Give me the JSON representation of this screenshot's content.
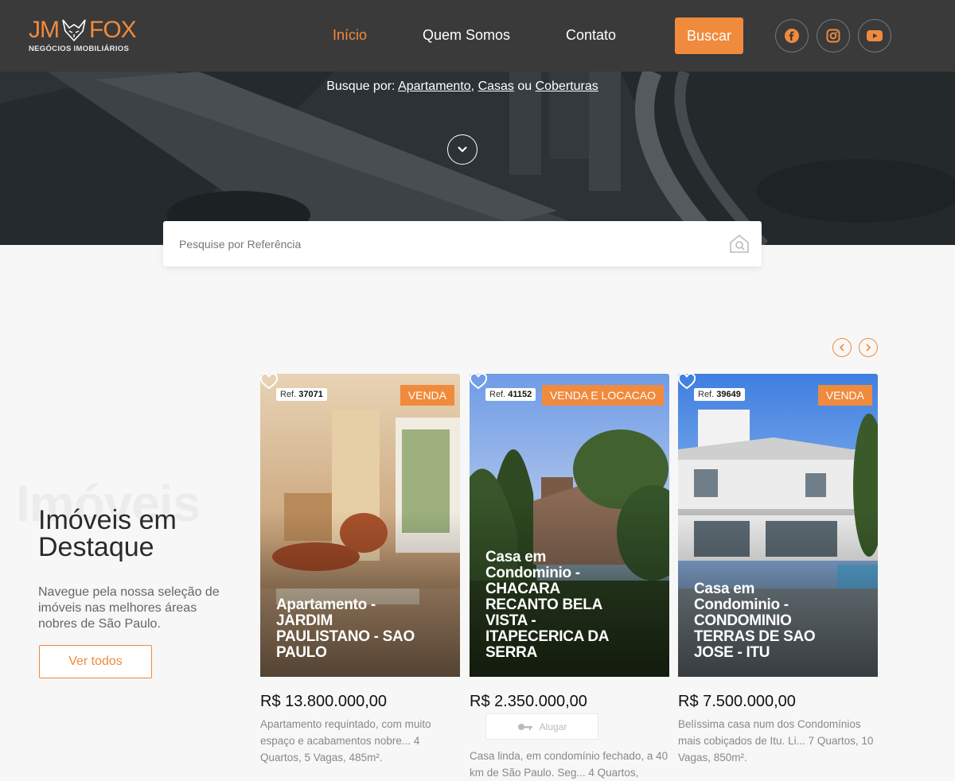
{
  "header": {
    "logo_main": "JM",
    "logo_main2": "FOX",
    "logo_sub": "NEGÓCIOS IMOBILIÁRIOS",
    "nav": [
      "Início",
      "Quem Somos",
      "Contato"
    ],
    "search_button": "Buscar",
    "social": [
      "facebook-icon",
      "instagram-icon",
      "youtube-icon"
    ],
    "accent_color": "#f08a3c"
  },
  "hero": {
    "prefix": "Busque por: ",
    "links": [
      "Apartamento",
      "Casas",
      "Coberturas"
    ],
    "sep1": ", ",
    "sep2": " ou "
  },
  "ref_search": {
    "placeholder": "Pesquise por Referência"
  },
  "featured": {
    "watermark": "Imóveis",
    "title": "Imóveis em Destaque",
    "description": "Navegue pela nossa seleção de imóveis nas melhores áreas nobres de São Paulo.",
    "button": "Ver todos"
  },
  "cards": [
    {
      "ref_label": "Ref.",
      "ref": "37071",
      "type": "VENDA",
      "title": "Apartamento - JARDIM PAULISTANO - SAO PAULO",
      "price": "R$ 13.800.000,00",
      "description": "Apartamento requintado, com muito espaço e acabamentos nobre... 4 Quartos, 5 Vagas, 485m²."
    },
    {
      "ref_label": "Ref.",
      "ref": "41152",
      "type": "VENDA E LOCACAO",
      "title": "Casa em Condominio - CHACARA RECANTO BELA VISTA - ITAPECERICA DA SERRA",
      "price": "R$ 2.350.000,00",
      "rent_button": "Alugar",
      "description": "Casa linda, em condomínio fechado, a 40 km de São Paulo. Seg... 4 Quartos,"
    },
    {
      "ref_label": "Ref.",
      "ref": "39649",
      "type": "VENDA",
      "title": "Casa em Condominio - CONDOMINIO TERRAS DE SAO JOSE - ITU",
      "price": "R$ 7.500.000,00",
      "description": "Belíssima casa num dos Condomínios mais cobiçados de Itu. Li... 7 Quartos, 10 Vagas, 850m²."
    }
  ]
}
